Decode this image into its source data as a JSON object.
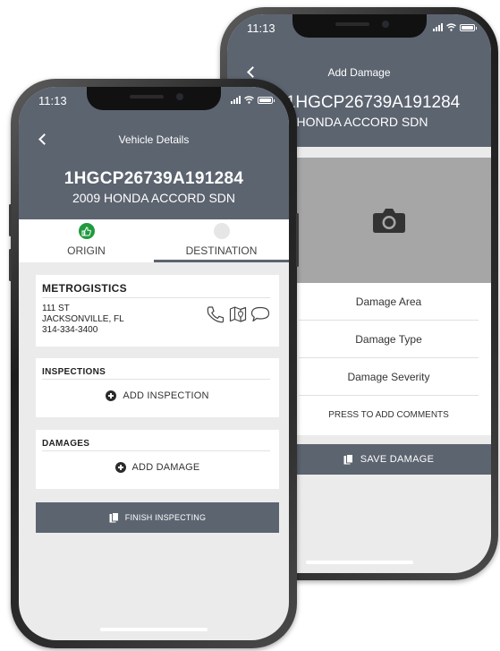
{
  "back_phone": {
    "status": {
      "time": "11:13"
    },
    "header": {
      "title": "Add Damage",
      "vin": "# 1HGCP26739A191284",
      "model": "09 HONDA ACCORD SDN"
    },
    "photo": {
      "icon": "camera-icon"
    },
    "damage_fields": {
      "area": "Damage Area",
      "type": "Damage Type",
      "severity": "Damage Severity",
      "comments": "PRESS TO ADD COMMENTS"
    },
    "save_button": {
      "label": "SAVE DAMAGE",
      "icon": "clipboard-icon"
    }
  },
  "front_phone": {
    "status": {
      "time": "11:13"
    },
    "header": {
      "title": "Vehicle Details",
      "vin": "1HGCP26739A191284",
      "model": "2009 HONDA ACCORD SDN"
    },
    "tabs": [
      {
        "label": "ORIGIN",
        "icon": "thumbs-up-icon",
        "active": false
      },
      {
        "label": "DESTINATION",
        "icon": "circle-icon",
        "active": true
      }
    ],
    "location": {
      "name": "METROGISTICS",
      "street": "111 ST",
      "city": "JACKSONVILLE, FL",
      "phone": "314-334-3400",
      "icons": [
        "phone-icon",
        "map-icon",
        "chat-icon"
      ]
    },
    "inspections": {
      "title": "INSPECTIONS",
      "add_label": "ADD INSPECTION"
    },
    "damages": {
      "title": "DAMAGES",
      "add_label": "ADD DAMAGE"
    },
    "finish_button": {
      "label": "FINISH INSPECTING",
      "icon": "clipboard-icon"
    }
  },
  "colors": {
    "header": "#5c6470",
    "screen_bg": "#ebebeb",
    "accent_green": "#1f9a3e",
    "photo_bg": "#a6a6a6"
  }
}
